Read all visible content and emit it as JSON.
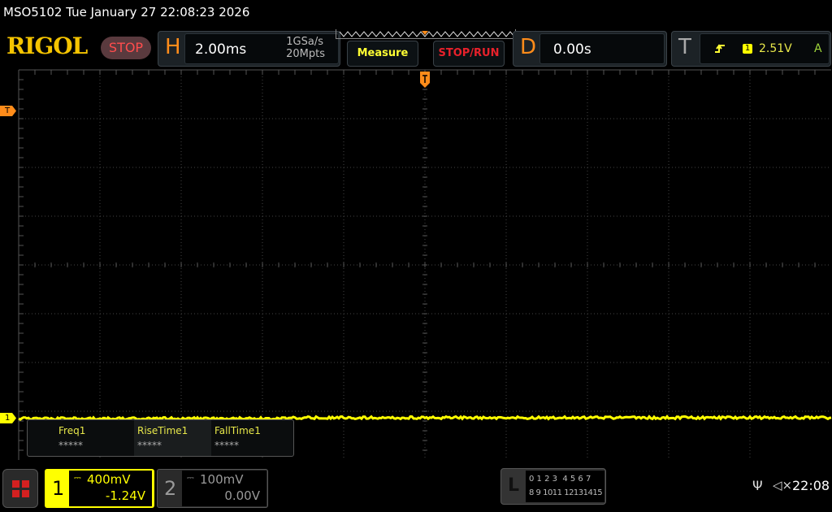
{
  "title_bar": "MSO5102  Tue January 27 22:08:23 2026",
  "logo": "RIGOL",
  "run_status": "STOP",
  "horizontal": {
    "letter": "H",
    "timebase": "2.00ms",
    "sample_rate": "1GSa/s",
    "memory_depth": "20Mpts"
  },
  "buttons": {
    "measure": "Measure",
    "stop_run": "STOP/RUN"
  },
  "delay": {
    "letter": "D",
    "value": "0.00s"
  },
  "trigger": {
    "letter": "T",
    "edge_icon": "rising-edge-icon",
    "source": "1",
    "level": "2.51V",
    "mode": "A",
    "marker": "T"
  },
  "channel_marker": "1",
  "measurements": [
    {
      "label": "Freq1",
      "value": "*****"
    },
    {
      "label": "RiseTime1",
      "value": "*****"
    },
    {
      "label": "FallTime1",
      "value": "*****"
    }
  ],
  "channels": [
    {
      "num": "1",
      "scale": "400mV",
      "offset": "-1.24V",
      "color": "#ffff00",
      "active": true
    },
    {
      "num": "2",
      "scale": "100mV",
      "offset": "0.00V",
      "color": "#888888",
      "active": false
    }
  ],
  "logic": {
    "letter": "L",
    "row1": "0 1 2 3  4 5 6 7",
    "row2": "8 9 1011 12131415"
  },
  "status": {
    "usb_icon": "usb-icon",
    "sound_icon": "speaker-muted-icon",
    "clock": "22:08"
  },
  "colors": {
    "trace": "#ffff00",
    "accent": "#ff8c1a",
    "stop": "#ff4d4d"
  }
}
